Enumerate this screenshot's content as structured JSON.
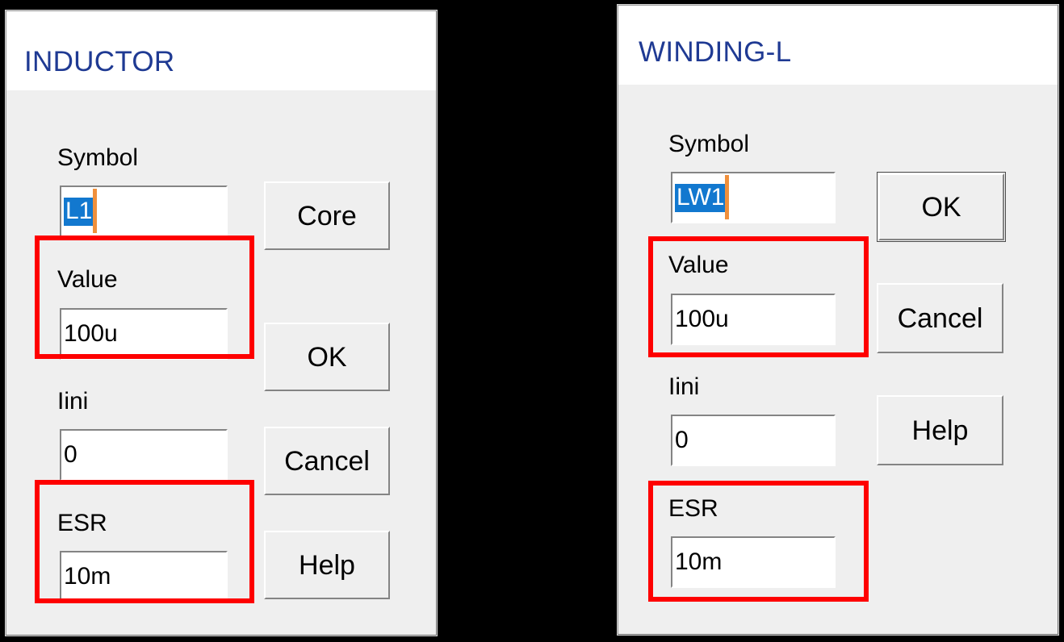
{
  "background_color": "#000000",
  "annotation_color": "#fe0000",
  "title_color": "#1f3a93",
  "selection_color": "#1278cf",
  "caret_color": "#f0903c",
  "dialogs": [
    {
      "id": "inductor",
      "title": "INDUCTOR",
      "fields": [
        {
          "label": "Symbol",
          "value": "L1",
          "selected": true,
          "highlighted": false
        },
        {
          "label": "Value",
          "value": "100u",
          "selected": false,
          "highlighted": true
        },
        {
          "label": "Iini",
          "value": "0",
          "selected": false,
          "highlighted": false
        },
        {
          "label": "ESR",
          "value": "10m",
          "selected": false,
          "highlighted": true
        }
      ],
      "buttons": [
        {
          "label": "Core",
          "default": false
        },
        {
          "label": "OK",
          "default": false
        },
        {
          "label": "Cancel",
          "default": false
        },
        {
          "label": "Help",
          "default": false
        }
      ]
    },
    {
      "id": "winding-l",
      "title": "WINDING-L",
      "fields": [
        {
          "label": "Symbol",
          "value": "LW1",
          "selected": true,
          "highlighted": false
        },
        {
          "label": "Value",
          "value": "100u",
          "selected": false,
          "highlighted": true
        },
        {
          "label": "Iini",
          "value": "0",
          "selected": false,
          "highlighted": false
        },
        {
          "label": "ESR",
          "value": "10m",
          "selected": false,
          "highlighted": true
        }
      ],
      "buttons": [
        {
          "label": "OK",
          "default": true
        },
        {
          "label": "Cancel",
          "default": false
        },
        {
          "label": "Help",
          "default": false
        }
      ]
    }
  ]
}
